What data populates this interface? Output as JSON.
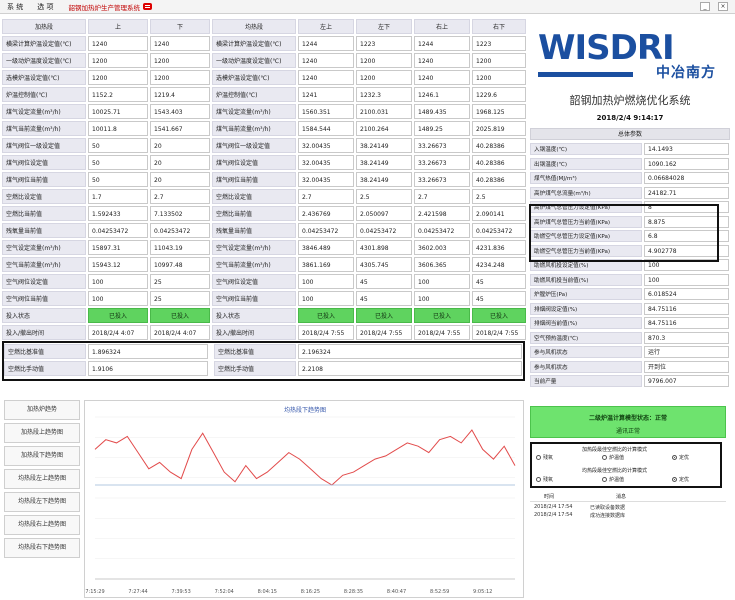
{
  "menu": {
    "items": [
      "系 统",
      "选 项"
    ],
    "title": "韶钢加热炉生产管理系统"
  },
  "window": {
    "minimize": "_",
    "close": "×"
  },
  "section1": {
    "columns": [
      "加热段",
      "上",
      "下"
    ],
    "rows": [
      [
        "横梁计算炉温设定值(℃)",
        "1240",
        "1240"
      ],
      [
        "一级动炉温度设定值(℃)",
        "1200",
        "1200"
      ],
      [
        "选模炉温设定值(℃)",
        "1200",
        "1200"
      ],
      [
        "炉温控制值(℃)",
        "1152.2",
        "1219.4"
      ],
      [
        "煤气设定流量(m³/h)",
        "10025.71",
        "1543.403"
      ],
      [
        "煤气当前流量(m³/h)",
        "10011.8",
        "1541.667"
      ],
      [
        "煤气阀位一级设定值",
        "50",
        "20"
      ],
      [
        "煤气阀位设定值",
        "50",
        "20"
      ],
      [
        "煤气阀位当前值",
        "50",
        "20"
      ],
      [
        "空燃比设定值",
        "1.7",
        "2.7"
      ],
      [
        "空燃比当前值",
        "1.592433",
        "7.133502"
      ],
      [
        "残氧量当前值",
        "0.04253472",
        "0.04253472"
      ],
      [
        "空气设定流量(m³/h)",
        "15897.31",
        "11043.19"
      ],
      [
        "空气当前流量(m³/h)",
        "15943.12",
        "10997.48"
      ],
      [
        "空气阀位设定值",
        "100",
        "25"
      ],
      [
        "空气阀位当前值",
        "100",
        "25"
      ],
      [
        "投入状态",
        "已投入",
        "已投入"
      ],
      [
        "投入/撤出时间",
        "2018/2/4 4:07",
        "2018/2/4 4:07"
      ]
    ]
  },
  "section2": {
    "columns": [
      "均热段",
      "左上",
      "左下",
      "右上",
      "右下"
    ],
    "rows": [
      [
        "横梁计算炉温设定值(℃)",
        "1244",
        "1223",
        "1244",
        "1223"
      ],
      [
        "一级动炉温度设定值(℃)",
        "1240",
        "1200",
        "1240",
        "1200"
      ],
      [
        "选模炉温设定值(℃)",
        "1240",
        "1200",
        "1240",
        "1200"
      ],
      [
        "炉温控制值(℃)",
        "1241",
        "1232.3",
        "1246.1",
        "1229.6"
      ],
      [
        "煤气设定流量(m³/h)",
        "1560.351",
        "2100.031",
        "1489.435",
        "1968.125"
      ],
      [
        "煤气当前流量(m³/h)",
        "1584.544",
        "2100.264",
        "1489.25",
        "2025.819"
      ],
      [
        "煤气阀位一级设定值",
        "32.00435",
        "38.24149",
        "33.26673",
        "40.28386"
      ],
      [
        "煤气阀位设定值",
        "32.00435",
        "38.24149",
        "33.26673",
        "40.28386"
      ],
      [
        "煤气阀位当前值",
        "32.00435",
        "38.24149",
        "33.26673",
        "40.28386"
      ],
      [
        "空燃比设定值",
        "2.7",
        "2.5",
        "2.7",
        "2.5"
      ],
      [
        "空燃比当前值",
        "2.436769",
        "2.050097",
        "2.421598",
        "2.090141"
      ],
      [
        "残氧量当前值",
        "0.04253472",
        "0.04253472",
        "0.04253472",
        "0.04253472"
      ],
      [
        "空气设定流量(m³/h)",
        "3846.489",
        "4301.898",
        "3602.003",
        "4231.836"
      ],
      [
        "空气当前流量(m³/h)",
        "3861.169",
        "4305.745",
        "3606.365",
        "4234.248"
      ],
      [
        "空气阀位设定值",
        "100",
        "45",
        "100",
        "45"
      ],
      [
        "空气阀位当前值",
        "100",
        "45",
        "100",
        "45"
      ],
      [
        "投入状态",
        "已投入",
        "已投入",
        "已投入",
        "已投入"
      ],
      [
        "投入/撤出时间",
        "2018/2/4 7:55",
        "2018/2/4 7:55",
        "2018/2/4 7:55",
        "2018/2/4 7:55"
      ]
    ]
  },
  "ratio": {
    "rows": [
      {
        "label": "空燃比基准值",
        "value": "1.896324",
        "label2": "空燃比基准值",
        "value2": "2.196324"
      },
      {
        "label": "空燃比手动值",
        "value": "1.9106",
        "label2": "空燃比手动值",
        "value2": "2.2108"
      }
    ]
  },
  "nav": [
    "加热炉趋势",
    "加热段上趋势图",
    "加热段下趋势图",
    "均热段左上趋势图",
    "均热段左下趋势图",
    "均热段右上趋势图",
    "均热段右下趋势图"
  ],
  "chart_data": {
    "type": "line",
    "title": "均热段下趋势图",
    "x": [
      "7:15:29",
      "7:18",
      "7:21",
      "7:24",
      "7:27:44",
      "7:30",
      "7:33",
      "7:36",
      "7:39:53",
      "7:43",
      "7:46",
      "7:49",
      "7:52:04",
      "7:55",
      "7:58",
      "8:01",
      "8:04:15",
      "8:07",
      "8:10",
      "8:13",
      "8:16:25",
      "8:19",
      "8:22",
      "8:25",
      "8:28:35",
      "8:31",
      "8:34",
      "8:37",
      "8:40:47",
      "8:44",
      "8:47",
      "8:50",
      "8:52:59",
      "8:56",
      "8:59",
      "9:02",
      "9:05:12",
      "9:08",
      "9:11",
      "9:14"
    ],
    "xticks": [
      "7:15:29",
      "7:27:44",
      "7:39:53",
      "7:52:04",
      "8:04:15",
      "8:16:25",
      "8:28:35",
      "8:40:47",
      "8:52:59",
      "9:05:12"
    ],
    "series": [
      {
        "values": [
          80,
          86,
          84,
          88,
          78,
          68,
          72,
          66,
          62,
          80,
          90,
          78,
          66,
          60,
          70,
          62,
          66,
          72,
          78,
          74,
          68,
          62,
          58,
          64,
          66,
          70,
          74,
          76,
          80,
          84,
          82,
          78,
          86,
          88,
          84,
          92,
          80,
          74,
          82,
          70
        ],
        "color": "#e24b4b"
      },
      {
        "values": [
          58,
          58,
          58,
          58,
          58,
          58,
          58,
          58,
          58,
          58,
          58,
          58,
          58,
          58,
          58,
          58,
          58,
          58,
          58,
          58,
          58,
          58,
          58,
          58,
          58,
          58,
          58,
          58,
          58,
          58,
          58,
          58,
          58,
          58,
          58,
          58,
          58,
          58,
          58,
          58
        ],
        "color": "#9ab6d9"
      }
    ],
    "ylim": [
      0,
      100
    ],
    "grid": true
  },
  "right": {
    "logo_text": "WISDRI",
    "logo_cn": "中冶南方",
    "title": "韶钢加热炉燃烧优化系统",
    "time": "2018/2/4 9:14:17",
    "params_header": "总体参数",
    "params": [
      [
        "入钢温度(℃)",
        "14.1493"
      ],
      [
        "出钢温度(℃)",
        "1090.162"
      ],
      [
        "煤气热值(MJ/m³)",
        "0.06684028"
      ],
      [
        "高炉煤气总流量(m³/h)",
        "24182.71"
      ],
      [
        "高炉煤气总管压力设定值(KPa)",
        "8"
      ],
      [
        "高炉煤气总管压力当前值(KPa)",
        "8.875"
      ],
      [
        "助燃空气总管压力设定值(KPa)",
        "6.8"
      ],
      [
        "助燃空气总管压力当前值(KPa)",
        "4.902778"
      ],
      [
        "助燃风机投设定值(%)",
        "100"
      ],
      [
        "助燃风机投当前值(%)",
        "100"
      ],
      [
        "炉膛炉压(Pa)",
        "6.018524"
      ],
      [
        "排烟阀设定值(%)",
        "84.75116"
      ],
      [
        "排烟阀当前值(%)",
        "84.75116"
      ],
      [
        "空气预热温度(℃)",
        "870.3"
      ],
      [
        "参与风机状态",
        "运行"
      ],
      [
        "参与风机状态",
        "开到位"
      ],
      [
        "当前产量",
        "9796.007"
      ]
    ],
    "status1": "二级炉温计算模型状态：正常",
    "status2": "通讯正常",
    "opt1_title": "加热段最佳空燃比的计算模式",
    "opt2_title": "均热段最佳空燃比的计算模式",
    "opt_a": "残氧",
    "opt_b": "炉温值",
    "opt_c": "定优",
    "msg_cols": [
      "时间",
      "消息"
    ],
    "msgs": [
      [
        "2018/2/4 17:54",
        "已读取设备数据"
      ],
      [
        "2018/2/4 17:54",
        "成功连接数据库"
      ]
    ]
  }
}
